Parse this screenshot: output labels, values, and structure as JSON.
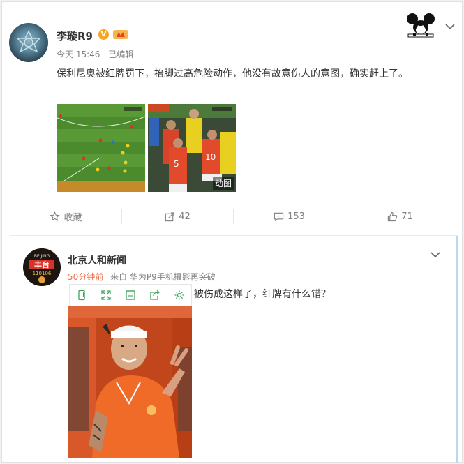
{
  "post": {
    "author": "李璇R9",
    "verified_badge": "V",
    "time": "今天 15:46",
    "edited": "已编辑",
    "text": "保利尼奥被红牌罚下，抬脚过高危险动作，他没有故意伤人的意图，确实赶上了。",
    "gif_tag": "动图",
    "actions": {
      "favorite": "收藏",
      "repost_count": "42",
      "comment_count": "153",
      "like_count": "71"
    }
  },
  "comment": {
    "author": "北京人和新闻",
    "avatar_text_top": "BEIJING",
    "avatar_text_mid": "丰台",
    "avatar_text_bottom": "110106",
    "time": "50分钟前",
    "source": "来自 华为P9手机摄影再突破",
    "text": "被伤成这样了，红牌有什么错？"
  },
  "colors": {
    "accent_orange": "#eb7350",
    "badge_gold": "#f5a623",
    "meta_gray": "#808080"
  },
  "icons": [
    "mickey-icon",
    "chevron-down-icon",
    "star-icon",
    "repost-icon",
    "comment-icon",
    "like-icon",
    "phone-icon",
    "expand-icon",
    "save-icon",
    "share-icon",
    "gear-icon"
  ]
}
